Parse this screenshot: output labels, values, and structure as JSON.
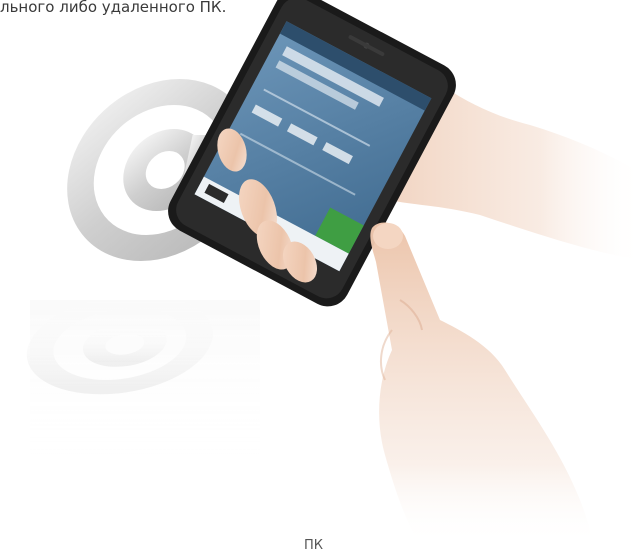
{
  "caption": {
    "top": "льного либо удаленного ПК.",
    "bottom": "ПК"
  },
  "emblem": {
    "symbol": "@",
    "color": "#d4d4d4"
  },
  "phone": {
    "body_color": "#1a1a1a",
    "screen_color": "#4d7aa0",
    "button_color": "#3f9e43"
  },
  "hands": {
    "skin_color": "#efc9b0"
  }
}
